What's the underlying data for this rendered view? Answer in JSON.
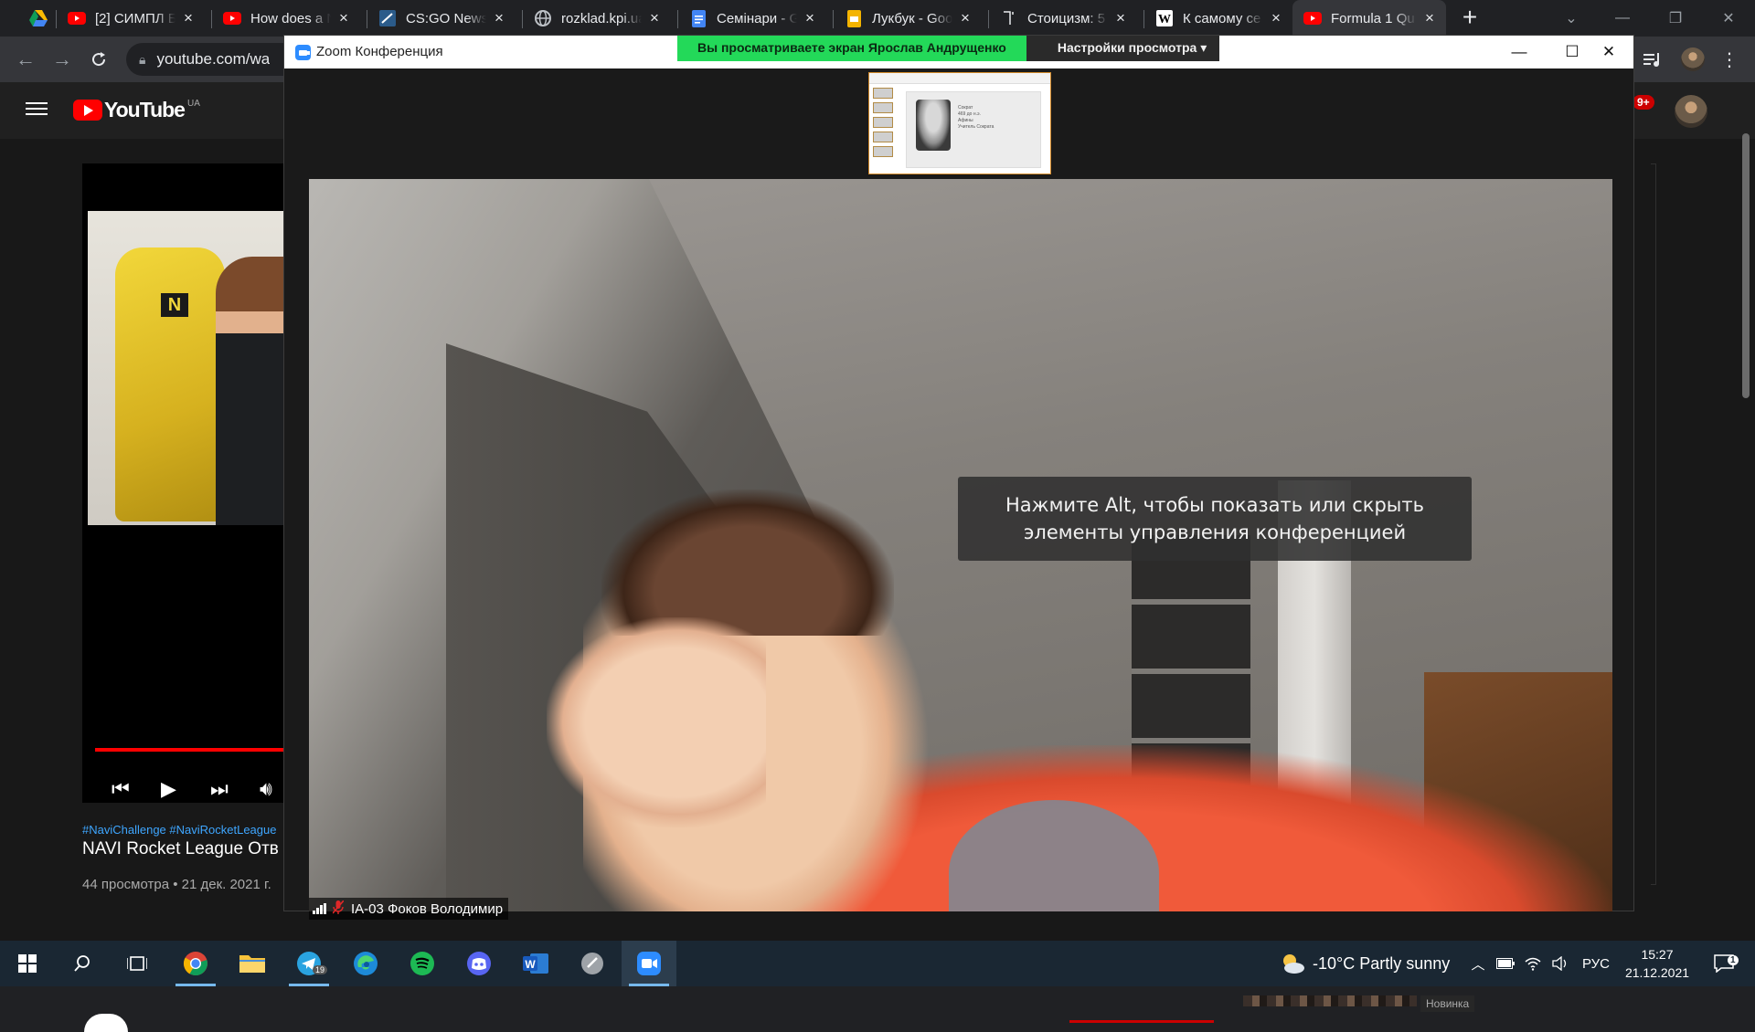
{
  "browser": {
    "tabs": [
      {
        "title": "[2] СИМПЛ Б",
        "icon": "youtube"
      },
      {
        "title": "How does a N",
        "icon": "youtube"
      },
      {
        "title": "CS:GO News",
        "icon": "csgo"
      },
      {
        "title": "rozklad.kpi.ua",
        "icon": "globe"
      },
      {
        "title": "Семінари - G",
        "icon": "google-docs"
      },
      {
        "title": "Лукбук - Goo",
        "icon": "google-slides"
      },
      {
        "title": "Стоицизм: 5",
        "icon": "bookmark"
      },
      {
        "title": "К самому се",
        "icon": "wikipedia"
      },
      {
        "title": "Formula 1 Qu",
        "icon": "youtube"
      }
    ],
    "active_tab_index": 8,
    "url": "youtube.com/wa"
  },
  "youtube": {
    "region": "UA",
    "notifications_badge": "9+",
    "hashtags": "#NaviChallenge #NaviRocketLeague",
    "video_title": "NAVI Rocket League Отв",
    "video_meta": "44 просмотра • 21 дек. 2021 г.",
    "shelf_badge": "Новинка"
  },
  "zoom": {
    "window_title": "Zoom Конференция",
    "share_banner": "Вы просматриваете экран Ярослав Андрущенко",
    "view_options": "Настройки просмотра ▾",
    "shared_slide_text": [
      "Сократ",
      "469 до н.э.",
      "Афины",
      "Учитель Сократа"
    ],
    "hint_text": "Нажмите Alt, чтобы показать или скрыть элементы управления конференцией",
    "participant_name": "IA-03 Фоков Володимир"
  },
  "taskbar": {
    "apps": [
      "start",
      "search",
      "task-view",
      "chrome",
      "file-explorer",
      "telegram",
      "edge",
      "spotify",
      "discord",
      "word",
      "app",
      "zoom"
    ],
    "telegram_badge": "19",
    "weather": "-10°C  Partly sunny",
    "language": "РУС",
    "time": "15:27",
    "date": "21.12.2021",
    "notifications_count": "1"
  }
}
